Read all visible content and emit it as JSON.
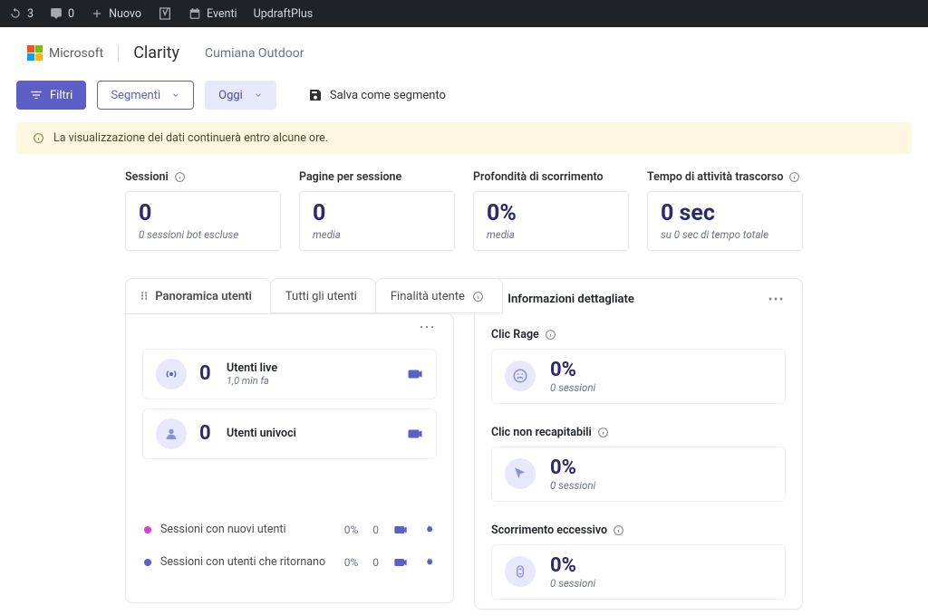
{
  "wpbar": {
    "updates_count": "3",
    "comments_count": "0",
    "new_label": "Nuovo",
    "events_label": "Eventi",
    "updraft_label": "UpdraftPlus"
  },
  "header": {
    "ms_label": "Microsoft",
    "product": "Clarity",
    "project": "Cumiana Outdoor"
  },
  "toolbar": {
    "filters": "Filtri",
    "segments": "Segmenti",
    "today": "Oggi",
    "save_segment": "Salva come segmento"
  },
  "notice": "La visualizzazione dei dati continuerà entro alcune ore.",
  "metrics": [
    {
      "label": "Sessioni",
      "value": "0",
      "sub": "0 sessioni bot escluse",
      "info": true
    },
    {
      "label": "Pagine per sessione",
      "value": "0",
      "sub": "media",
      "info": false
    },
    {
      "label": "Profondità di scorrimento",
      "value": "0%",
      "sub": "media",
      "info": false
    },
    {
      "label": "Tempo di attività trascorso",
      "value": "0 sec",
      "sub": "su 0 sec di tempo totale",
      "info": true
    }
  ],
  "userpanel": {
    "tabs": [
      "Panoramica utenti",
      "Tutti gli utenti",
      "Finalità utente"
    ],
    "live": {
      "count": "0",
      "label": "Utenti live",
      "sub": "1,0 min fa"
    },
    "unique": {
      "count": "0",
      "label": "Utenti univoci"
    },
    "legend": [
      {
        "color": "#d83ecf",
        "label": "Sessioni con nuovi utenti",
        "pct": "0%",
        "n": "0"
      },
      {
        "color": "#5b5fc7",
        "label": "Sessioni con utenti che ritornano",
        "pct": "0%",
        "n": "0"
      }
    ]
  },
  "insights": {
    "title": "Informazioni dettagliate",
    "items": [
      {
        "label": "Clic Rage",
        "value": "0%",
        "sub": "0 sessioni",
        "icon": "rage"
      },
      {
        "label": "Clic non recapitabili",
        "value": "0%",
        "sub": "0 sessioni",
        "icon": "cursor"
      },
      {
        "label": "Scorrimento eccessivo",
        "value": "0%",
        "sub": "0 sessioni",
        "icon": "scroll"
      }
    ]
  }
}
